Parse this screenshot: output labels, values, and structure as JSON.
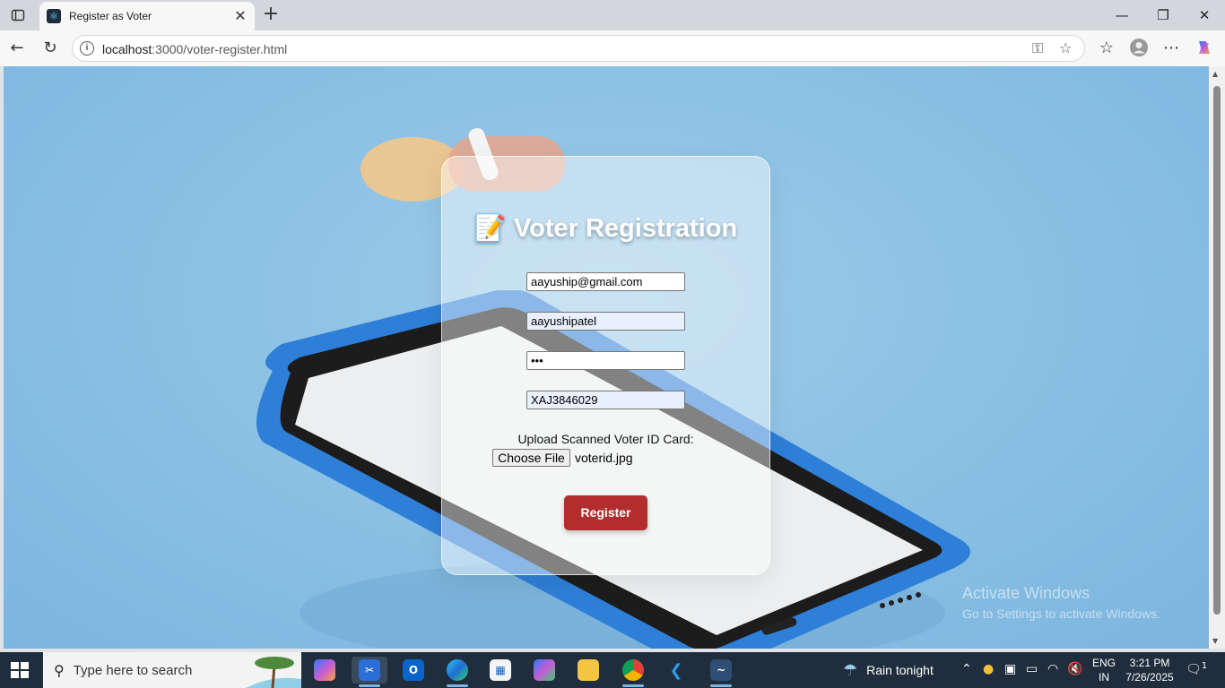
{
  "browser": {
    "tab_title": "Register as Voter",
    "url_host": "localhost",
    "url_path": ":3000/voter-register.html"
  },
  "form": {
    "title": "Voter Registration",
    "email_value": "aayuship@gmail.com",
    "username_value": "aayushipatel",
    "password_value": "•••",
    "voter_id_value": "XAJ3846029",
    "upload_label": "Upload Scanned Voter ID Card:",
    "choose_file_label": "Choose File",
    "file_name": "voterid.jpg",
    "register_label": "Register"
  },
  "watermark": {
    "line1": "Activate Windows",
    "line2": "Go to Settings to activate Windows."
  },
  "taskbar": {
    "search_placeholder": "Type here to search",
    "weather_text": "Rain tonight",
    "lang_line1": "ENG",
    "lang_line2": "IN",
    "time": "3:21 PM",
    "date": "7/26/2025",
    "notification_count": "1"
  },
  "colors": {
    "register_button": "#b22d2d",
    "page_background": "#88bee3",
    "taskbar": "#1f2d3d"
  }
}
